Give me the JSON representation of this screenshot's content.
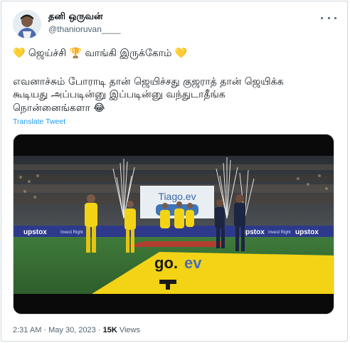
{
  "author": {
    "display_name": "தனி ஒருவன்",
    "handle": "@thanioruvan____"
  },
  "tweet": {
    "line1": "💛 ஜெய்ச்சி 🏆 வாங்கி இருக்கோம் 💛",
    "line2": "எவனாச்சும் போராடி தான் ஜெயிச்சது குஜராத் தான் ஜெயிக்க",
    "line3": "கூடியது அப்படின்னு இப்படின்னு வந்துடாதீங்க",
    "line4": "நொன்னைங்களா 😂",
    "translate_label": "Translate Tweet"
  },
  "media": {
    "sponsor_board": "Tiago.ev",
    "ad_board_text": "upstox",
    "ad_board_sub": "Invest Right",
    "ground_text_1": "go.",
    "ground_text_2": "ev"
  },
  "meta": {
    "time": "2:31 AM",
    "separator": " · ",
    "date": "May 30, 2023",
    "views_count": "15K",
    "views_label": "Views"
  },
  "colors": {
    "link": "#1d9bf0",
    "secondary_text": "#536471",
    "border": "#cfd9de",
    "csk_yellow": "#f2d316",
    "gt_navy": "#1c2541"
  },
  "icons": {
    "more": "more-horizontal-icon"
  }
}
